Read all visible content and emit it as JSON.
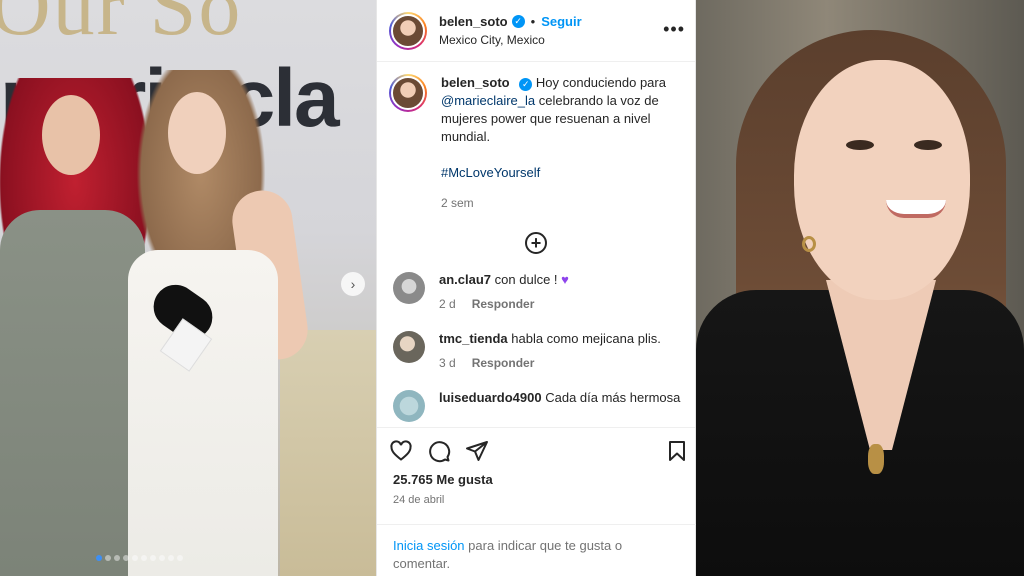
{
  "post": {
    "username": "belen_soto",
    "follow_label": "Seguir",
    "location": "Mexico City, Mexico",
    "separator": "•",
    "more_icon": "more-horizontal-icon",
    "caption": {
      "username": "belen_soto",
      "text_before": "Hoy conduciendo para",
      "mention": "@marieclaire_la",
      "text_after": "celebrando la voz de mujeres power que resuenan a nivel mundial.",
      "hashtag": "#McLoveYourself",
      "time": "2 sem"
    },
    "comments": [
      {
        "username": "an.clau7",
        "text": "con dulce !",
        "emoji": "♥",
        "time": "2 d",
        "reply_label": "Responder"
      },
      {
        "username": "tmc_tienda",
        "text": "habla como mejicana plis.",
        "time": "3 d",
        "reply_label": "Responder"
      },
      {
        "username": "luiseduardo4900",
        "text": "Cada día más hermosa"
      }
    ],
    "likes": "25.765 Me gusta",
    "date": "24 de abril",
    "login": {
      "link": "Inicia sesión",
      "text": "para indicar que te gusta o comentar."
    }
  },
  "photos": {
    "left_backdrop_text": "Our So",
    "left_brand_text": "marie cla",
    "carousel": {
      "count": 10,
      "active_index": 0
    }
  },
  "colors": {
    "link_blue": "#0095f6",
    "mention_blue": "#00376b",
    "muted_gray": "#737373",
    "heart_purple": "#8e44ec"
  }
}
